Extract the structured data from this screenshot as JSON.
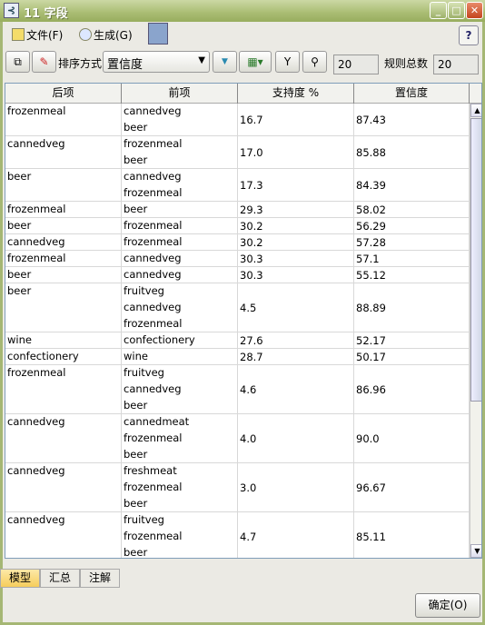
{
  "window": {
    "title": "11 字段",
    "accent": "#a9bc72"
  },
  "menu": {
    "file": "文件(F)",
    "generate": "生成(G)"
  },
  "toolbar": {
    "sort_label": "排序方式:",
    "sort_value": "置信度",
    "shown_count": "20",
    "total_label": "规则总数",
    "total_count": "20"
  },
  "table": {
    "headers": [
      "后项",
      "前项",
      "支持度 %",
      "置信度"
    ],
    "rows": [
      {
        "consequent": "frozenmeal",
        "antecedents": [
          "cannedveg",
          "beer"
        ],
        "support": "16.7",
        "confidence": "87.43"
      },
      {
        "consequent": "cannedveg",
        "antecedents": [
          "frozenmeal",
          "beer"
        ],
        "support": "17.0",
        "confidence": "85.88"
      },
      {
        "consequent": "beer",
        "antecedents": [
          "cannedveg",
          "frozenmeal"
        ],
        "support": "17.3",
        "confidence": "84.39"
      },
      {
        "consequent": "frozenmeal",
        "antecedents": [
          "beer"
        ],
        "support": "29.3",
        "confidence": "58.02"
      },
      {
        "consequent": "beer",
        "antecedents": [
          "frozenmeal"
        ],
        "support": "30.2",
        "confidence": "56.29"
      },
      {
        "consequent": "cannedveg",
        "antecedents": [
          "frozenmeal"
        ],
        "support": "30.2",
        "confidence": "57.28"
      },
      {
        "consequent": "frozenmeal",
        "antecedents": [
          "cannedveg"
        ],
        "support": "30.3",
        "confidence": "57.1"
      },
      {
        "consequent": "beer",
        "antecedents": [
          "cannedveg"
        ],
        "support": "30.3",
        "confidence": "55.12"
      },
      {
        "consequent": "beer",
        "antecedents": [
          "fruitveg",
          "cannedveg",
          "frozenmeal"
        ],
        "support": "4.5",
        "confidence": "88.89"
      },
      {
        "consequent": "wine",
        "antecedents": [
          "confectionery"
        ],
        "support": "27.6",
        "confidence": "52.17"
      },
      {
        "consequent": "confectionery",
        "antecedents": [
          "wine"
        ],
        "support": "28.7",
        "confidence": "50.17"
      },
      {
        "consequent": "frozenmeal",
        "antecedents": [
          "fruitveg",
          "cannedveg",
          "beer"
        ],
        "support": "4.6",
        "confidence": "86.96"
      },
      {
        "consequent": "cannedveg",
        "antecedents": [
          "cannedmeat",
          "frozenmeal",
          "beer"
        ],
        "support": "4.0",
        "confidence": "90.0"
      },
      {
        "consequent": "cannedveg",
        "antecedents": [
          "freshmeat",
          "frozenmeal",
          "beer"
        ],
        "support": "3.0",
        "confidence": "96.67"
      },
      {
        "consequent": "cannedveg",
        "antecedents": [
          "fruitveg",
          "frozenmeal",
          "beer"
        ],
        "support": "4.7",
        "confidence": "85.11"
      }
    ]
  },
  "tabs": [
    {
      "label": "模型",
      "active": true
    },
    {
      "label": "汇总"
    },
    {
      "label": "注解"
    }
  ],
  "ok_label": "确定(O)"
}
